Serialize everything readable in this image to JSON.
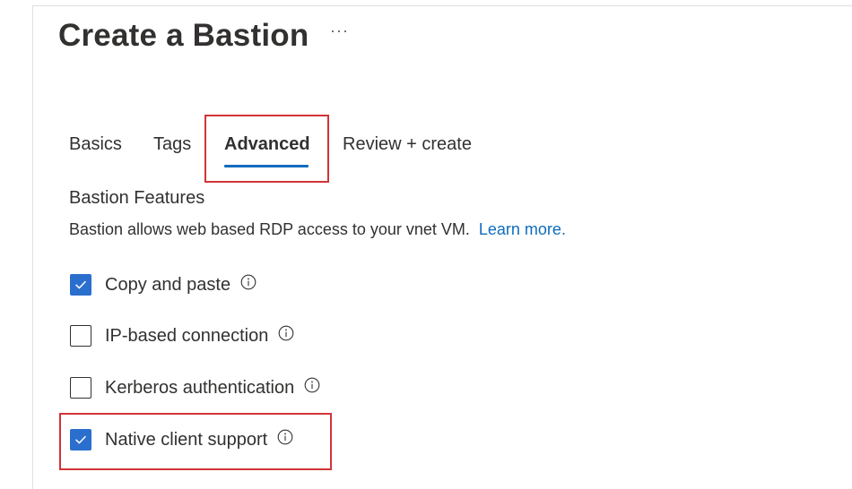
{
  "header": {
    "title": "Create a Bastion",
    "more_label": "···"
  },
  "tabs": [
    {
      "label": "Basics"
    },
    {
      "label": "Tags"
    },
    {
      "label": "Advanced"
    },
    {
      "label": "Review + create"
    }
  ],
  "active_tab": "Advanced",
  "section": {
    "title": "Bastion Features",
    "description": "Bastion allows web based RDP access to your vnet VM.",
    "learn_more": "Learn more."
  },
  "features": [
    {
      "label": "Copy and paste",
      "checked": true
    },
    {
      "label": "IP-based connection",
      "checked": false
    },
    {
      "label": "Kerberos authentication",
      "checked": false
    },
    {
      "label": "Native client support",
      "checked": true
    }
  ],
  "colors": {
    "accent": "#0f6cbd",
    "checkbox_checked": "#2b6fce",
    "highlight_border": "#d13438"
  },
  "icons": {
    "info": "info-icon",
    "check": "checkmark-icon",
    "more": "more-icon"
  }
}
